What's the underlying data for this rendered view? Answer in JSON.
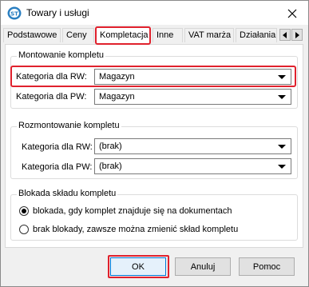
{
  "window": {
    "title": "Towary i usługi",
    "app_icon": "app-logo-icon",
    "close_icon": "close-icon"
  },
  "tabs": [
    {
      "label": "Podstawowe",
      "active": false
    },
    {
      "label": "Ceny",
      "active": false
    },
    {
      "label": "Kompletacja",
      "active": true
    },
    {
      "label": "Inne",
      "active": false
    },
    {
      "label": "VAT marża",
      "active": false
    },
    {
      "label": "Działania",
      "active": false
    }
  ],
  "tab_scroll": {
    "left_icon": "arrow-left-icon",
    "right_icon": "arrow-right-icon"
  },
  "montowanie": {
    "title": "Montowanie kompletu",
    "rw_label": "Kategoria dla RW:",
    "rw_value": "Magazyn",
    "pw_label": "Kategoria dla PW:",
    "pw_value": "Magazyn"
  },
  "rozmontowanie": {
    "title": "Rozmontowanie kompletu",
    "rw_label": "Kategoria dla RW:",
    "rw_value": "(brak)",
    "pw_label": "Kategoria dla PW:",
    "pw_value": "(brak)"
  },
  "blokada": {
    "title": "Blokada składu kompletu",
    "options": [
      {
        "label": "blokada, gdy komplet znajduje się na dokumentach",
        "checked": true
      },
      {
        "label": "brak blokady, zawsze można zmienić skład kompletu",
        "checked": false
      }
    ]
  },
  "buttons": {
    "ok": "OK",
    "cancel": "Anuluj",
    "help": "Pomoc"
  },
  "colors": {
    "highlight": "#e0212d",
    "accent": "#0078d7"
  }
}
